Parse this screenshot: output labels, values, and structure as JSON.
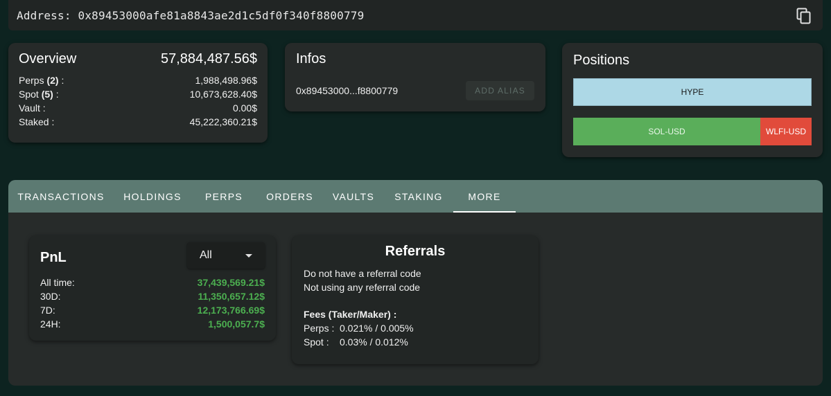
{
  "address_bar": {
    "label": "Address: 0x89453000afe81a8843ae2d1c5df0f340f8800779",
    "copy_icon": "copy-icon"
  },
  "overview": {
    "title": "Overview",
    "total": "57,884,487.56$",
    "rows": [
      {
        "label_pre": "Perps ",
        "count": "(2)",
        "label_post": " :",
        "value": "1,988,498.96$"
      },
      {
        "label_pre": "Spot ",
        "count": "(5)",
        "label_post": " :",
        "value": "10,673,628.40$"
      },
      {
        "label_pre": "Vault :",
        "count": "",
        "label_post": "",
        "value": "0.00$"
      },
      {
        "label_pre": "Staked :",
        "count": "",
        "label_post": "",
        "value": "45,222,360.21$"
      }
    ]
  },
  "infos": {
    "title": "Infos",
    "address_short": "0x89453000...f8800779",
    "add_alias_label": "ADD ALIAS"
  },
  "positions": {
    "title": "Positions",
    "items": [
      {
        "label": "HYPE",
        "color": "#add8e6"
      },
      {
        "label": "SOL-USD",
        "color": "#5aae5a"
      },
      {
        "label": "WLFI-USD",
        "color": "#e14b3b"
      }
    ]
  },
  "tabs": [
    {
      "label": "TRANSACTIONS",
      "active": false
    },
    {
      "label": "HOLDINGS",
      "active": false
    },
    {
      "label": "PERPS",
      "active": false
    },
    {
      "label": "ORDERS",
      "active": false
    },
    {
      "label": "VAULTS",
      "active": false
    },
    {
      "label": "STAKING",
      "active": false
    },
    {
      "label": "MORE",
      "active": true
    }
  ],
  "pnl": {
    "title": "PnL",
    "period_select": "All",
    "rows": [
      {
        "label": "All time:",
        "value": "37,439,569.21$"
      },
      {
        "label": "30D:",
        "value": "11,350,657.12$"
      },
      {
        "label": "7D:",
        "value": "12,173,766.69$"
      },
      {
        "label": "24H:",
        "value": "1,500,057.7$"
      }
    ]
  },
  "referrals": {
    "title": "Referrals",
    "line1": "Do not have a referral code",
    "line2": "Not using any referral code",
    "fees_title": "Fees (Taker/Maker) :",
    "fees": [
      {
        "label": "Perps :",
        "value": "0.021% / 0.005%"
      },
      {
        "label": "Spot :",
        "value": "0.03% / 0.012%"
      }
    ]
  },
  "colors": {
    "background": "#0d2320",
    "card": "#262a29",
    "tab_bar": "#5c7a72",
    "pnl_positive": "#4caf50"
  }
}
